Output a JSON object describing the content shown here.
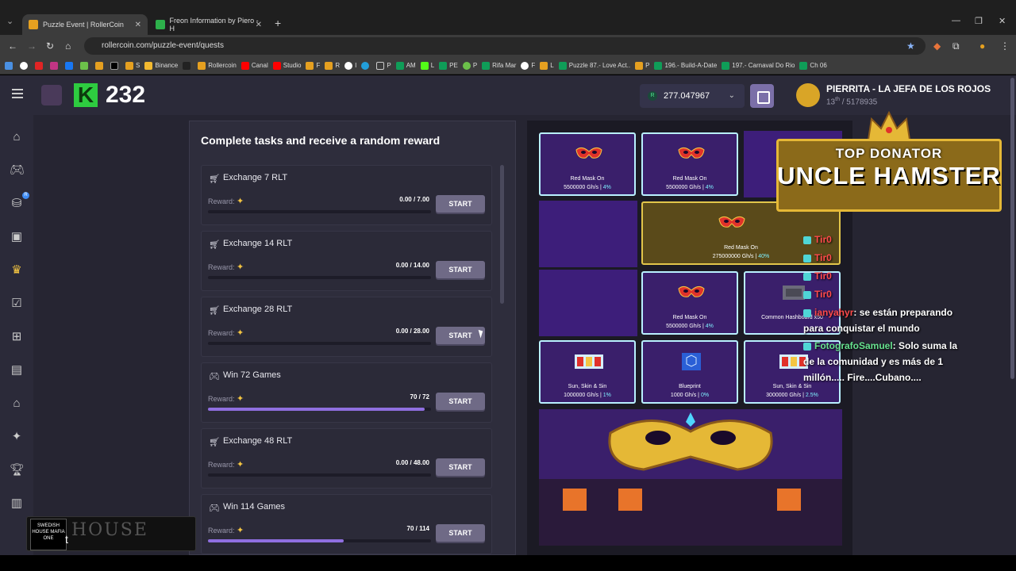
{
  "browser": {
    "tabs": [
      {
        "title": "Puzzle Event | RollerCoin",
        "active": true
      },
      {
        "title": "Freon Information by Piero - H",
        "active": false
      }
    ],
    "url": "rollercoin.com/puzzle-event/quests",
    "bookmarks": [
      "",
      "",
      "",
      "",
      "",
      "",
      "",
      "",
      "S",
      "Binance",
      "",
      "Rollercoin",
      "Canal",
      "Studio",
      "F",
      "R",
      "I",
      "",
      "P",
      "AM",
      "L",
      "PE",
      "P",
      "Rifa Mar",
      "F",
      "L",
      "Puzzle 87.- Love Act..",
      "P",
      "196.- Build-A-Date",
      "197.- Carnaval Do Rio",
      "Ch 06"
    ]
  },
  "header": {
    "k_count": "232",
    "balance": "277.047967",
    "balance_currency": "R",
    "profile_name": "PIERRITA - LA JEFA DE LOS ROJOS",
    "rank": "13",
    "rank_suffix": "th",
    "rank_total": "/ 5178935"
  },
  "quests": {
    "title": "Complete tasks and receive a random reward",
    "items": [
      {
        "icon": "cart-icon",
        "title": "Exchange 7 RLT",
        "reward_label": "Reward:",
        "progress": "0.00 / 7.00",
        "fill": 0.0,
        "button": "START"
      },
      {
        "icon": "cart-icon",
        "title": "Exchange 14 RLT",
        "reward_label": "Reward:",
        "progress": "0.00 / 14.00",
        "fill": 0.0,
        "button": "START"
      },
      {
        "icon": "cart-icon",
        "title": "Exchange 28 RLT",
        "reward_label": "Reward:",
        "progress": "0.00 / 28.00",
        "fill": 0.0,
        "button": "START"
      },
      {
        "icon": "gamepad-icon",
        "title": "Win 72 Games",
        "reward_label": "Reward:",
        "progress": "70 / 72",
        "fill": 0.97,
        "button": "START"
      },
      {
        "icon": "cart-icon",
        "title": "Exchange 48 RLT",
        "reward_label": "Reward:",
        "progress": "0.00 / 48.00",
        "fill": 0.0,
        "button": "START"
      },
      {
        "icon": "gamepad-icon",
        "title": "Win 114 Games",
        "reward_label": "Reward:",
        "progress": "70 / 114",
        "fill": 0.61,
        "button": "START"
      }
    ]
  },
  "puzzle": {
    "tiles": [
      {
        "name": "Red Mask On",
        "power": "5500000 Gh/s",
        "pct": "4%"
      },
      {
        "name": "Red Mask On",
        "power": "5500000 Gh/s",
        "pct": "4%"
      },
      {
        "name": "Red Mask On",
        "power": "275000000 Gh/s",
        "pct": "40%"
      },
      {
        "name": "Red Mask On",
        "power": "5500000 Gh/s",
        "pct": "4%"
      },
      {
        "name": "Common Hashboard x50",
        "power": "",
        "pct": ""
      },
      {
        "name": "Sun, Skin & Sin",
        "power": "1000000 Gh/s",
        "pct": "1%"
      },
      {
        "name": "Blueprint",
        "power": "1000 Gh/s",
        "pct": "0%"
      },
      {
        "name": "Sun, Skin & Sin",
        "power": "3000000 Gh/s",
        "pct": "2.5%"
      }
    ]
  },
  "overlay": {
    "banner_top": "TOP DONATOR",
    "banner_main": "UNCLE HAMSTER",
    "chat": [
      {
        "user": "Tir0",
        "text": ""
      },
      {
        "user": "Tir0",
        "text": ""
      },
      {
        "user": "Tir0",
        "text": ""
      },
      {
        "user": "Tir0",
        "text": ""
      },
      {
        "user": "ianyahyr",
        "text": ": se están preparando"
      },
      {
        "user": "",
        "text": "para conquistar el mundo"
      },
      {
        "user": "FotografoSamuel",
        "text": ": Solo suma la"
      },
      {
        "user": "",
        "text": "de la comunidad y es más de 1"
      },
      {
        "user": "",
        "text": "millón.....  Fire....Cubano...."
      }
    ],
    "stream_logo": "SWEDISH HOUSE MAFIA ONE",
    "stream_text": "HOUSE",
    "stream_letter": "t"
  }
}
